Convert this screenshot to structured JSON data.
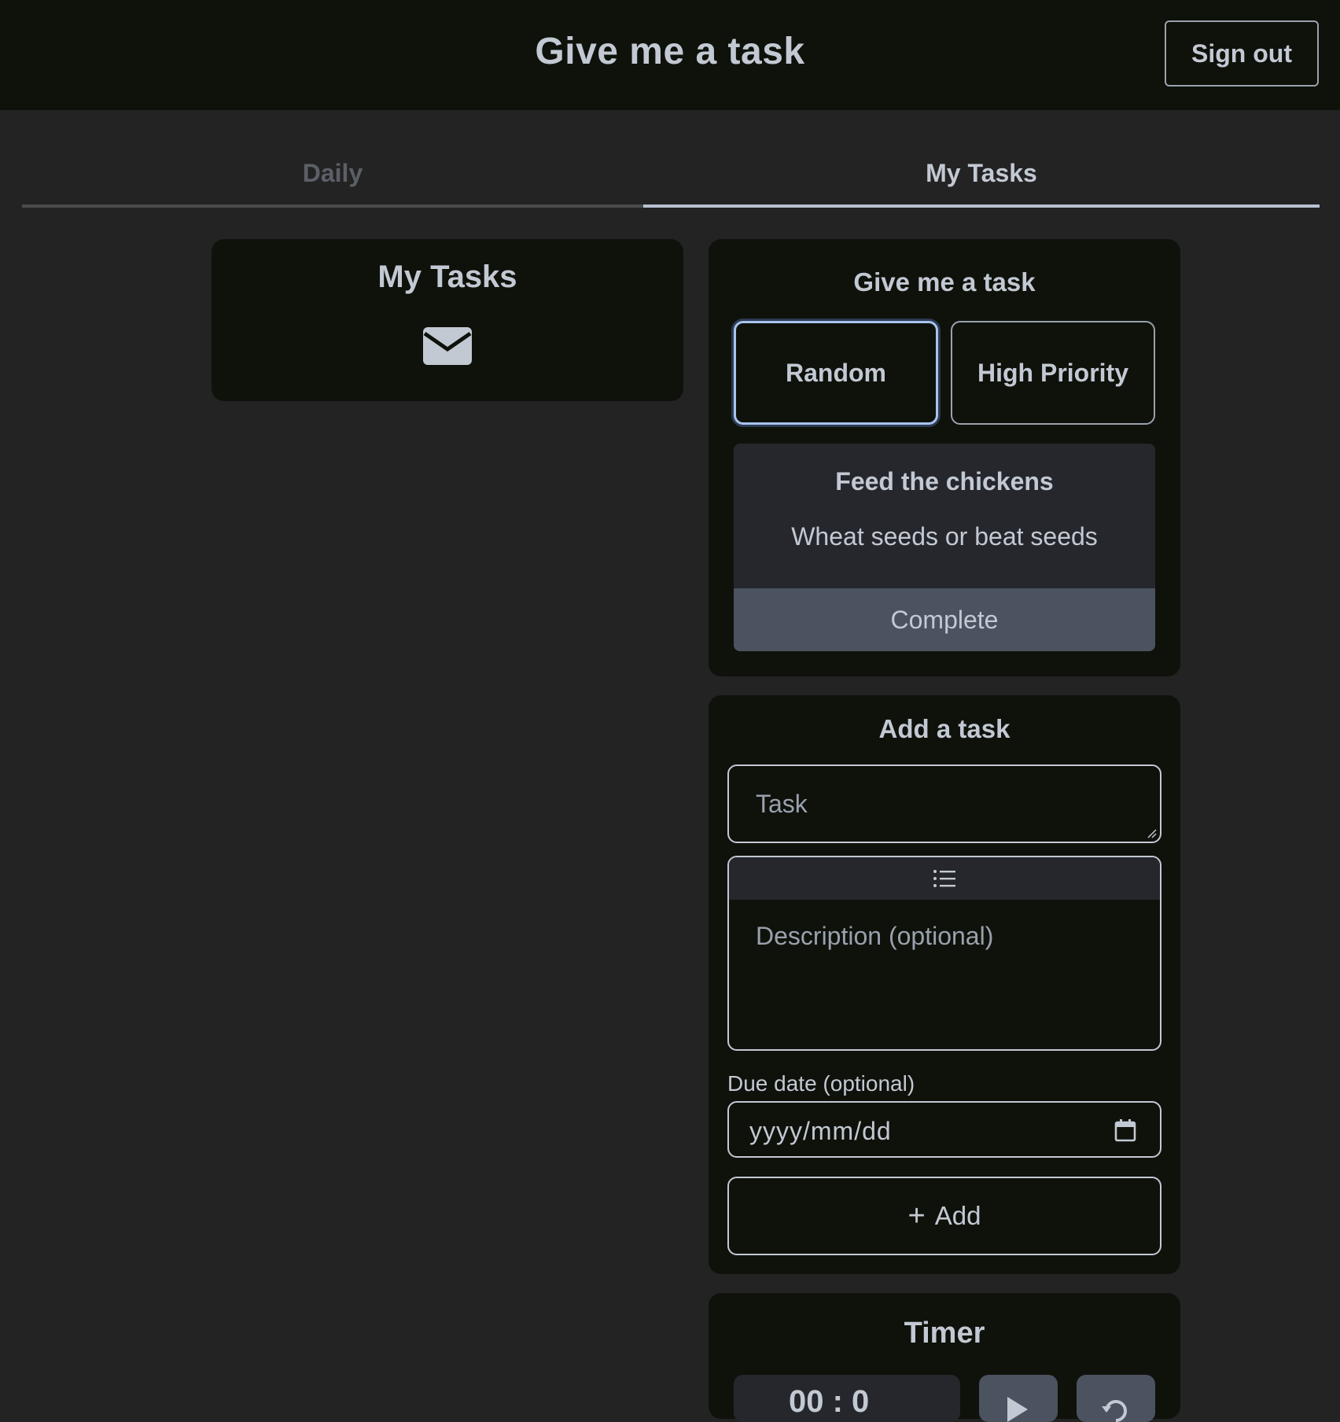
{
  "header": {
    "title": "Give me a task",
    "signout_label": "Sign out"
  },
  "tabs": [
    {
      "label": "Daily",
      "active": false
    },
    {
      "label": "My Tasks",
      "active": true
    }
  ],
  "my_tasks_card": {
    "title": "My Tasks",
    "icon": "envelope-icon"
  },
  "give_task_card": {
    "title": "Give me a task",
    "random_label": "Random",
    "high_priority_label": "High Priority",
    "current_task": {
      "name": "Feed the chickens",
      "description": "Wheat seeds or beat seeds",
      "complete_label": "Complete"
    }
  },
  "add_task_card": {
    "title": "Add a task",
    "task_placeholder": "Task",
    "description_placeholder": "Description (optional)",
    "toolbar_icon": "list-icon",
    "due_date_label": "Due date (optional)",
    "due_date_placeholder": "yyyy/mm/dd",
    "add_label": "Add",
    "add_icon": "plus-icon"
  },
  "timer_card": {
    "title": "Timer",
    "display": "00 : 0"
  },
  "colors": {
    "page_bg": "#232324",
    "card_bg": "#0f120b",
    "text": "#c3c9d3",
    "accent_border": "#a8c4ee",
    "complete_bg": "#4b5260"
  }
}
